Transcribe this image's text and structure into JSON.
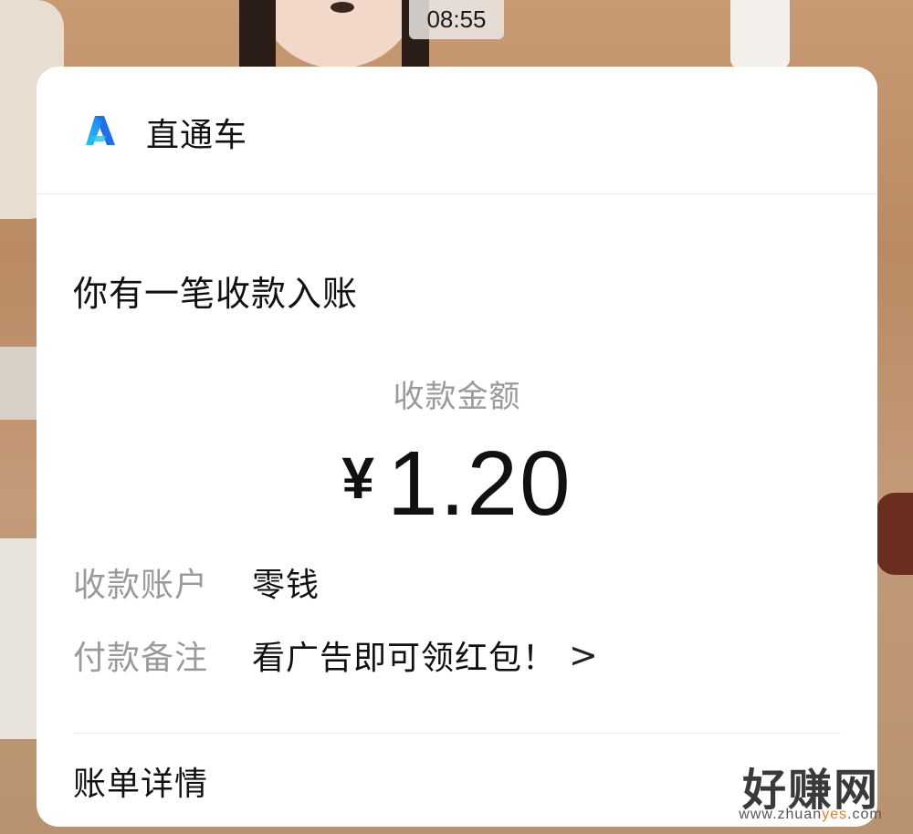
{
  "status_bar": {
    "time": "08:55"
  },
  "notification": {
    "app": {
      "name": "直通车",
      "icon": "app-logo-icon"
    },
    "title": "你有一笔收款入账",
    "amount_label": "收款金额",
    "currency_symbol": "¥",
    "amount": "1.20",
    "details": [
      {
        "label": "收款账户",
        "value": "零钱"
      },
      {
        "label": "付款备注",
        "value": "看广告即可领红包！"
      }
    ],
    "note_chevron": ">",
    "footer_link": "账单详情"
  },
  "watermark": {
    "main": "好赚网",
    "url_prefix": "zhuan",
    "url_accent": "yes",
    "url_suffix": ".com",
    "url_lead": "www."
  },
  "colors": {
    "logo_blue": "#1f7bf2",
    "logo_cyan": "#29c6f0",
    "label_gray": "#9a9a9a",
    "watermark_accent": "#e8792a"
  }
}
